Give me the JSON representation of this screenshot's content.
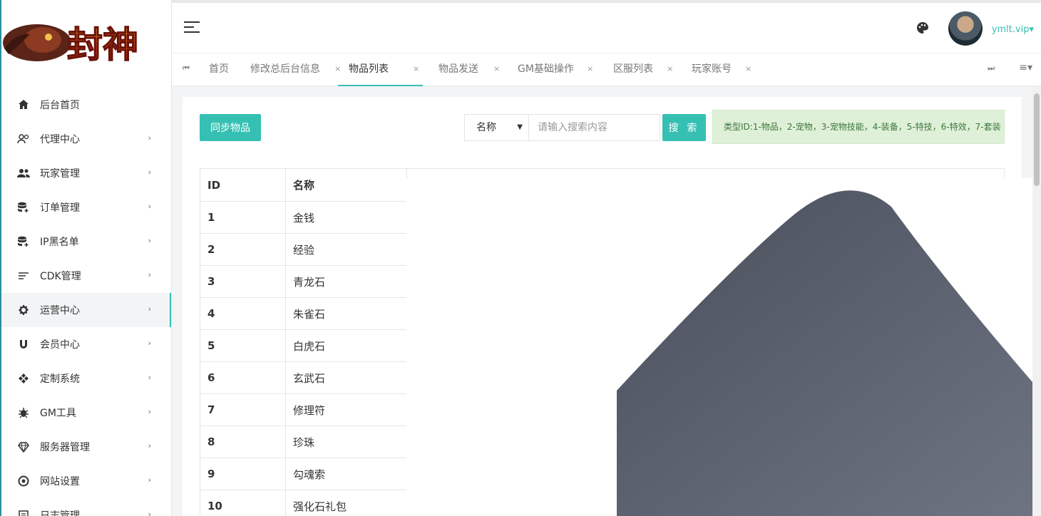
{
  "logo": {
    "text": "封神"
  },
  "sidebar": {
    "items": [
      {
        "label": "后台首页",
        "icon": "home-icon"
      },
      {
        "label": "代理中心",
        "icon": "users-outline-icon"
      },
      {
        "label": "玩家管理",
        "icon": "users-icon"
      },
      {
        "label": "订单管理",
        "icon": "database-add-icon"
      },
      {
        "label": "IP黑名单",
        "icon": "database-add-icon"
      },
      {
        "label": "CDK管理",
        "icon": "list-icon"
      },
      {
        "label": "运营中心",
        "icon": "gear-icon"
      },
      {
        "label": "会员中心",
        "icon": "magnet-icon"
      },
      {
        "label": "定制系统",
        "icon": "puzzle-icon"
      },
      {
        "label": "GM工具",
        "icon": "bug-icon"
      },
      {
        "label": "服务器管理",
        "icon": "diamond-icon"
      },
      {
        "label": "网站设置",
        "icon": "settings-circle-icon"
      },
      {
        "label": "日志管理",
        "icon": "log-icon"
      }
    ],
    "active_index": 6
  },
  "header": {
    "username": "ymlt.vip"
  },
  "tabs": [
    {
      "label": "首页"
    },
    {
      "label": "修改总后台信息"
    },
    {
      "label": "物品列表"
    },
    {
      "label": "物品发送"
    },
    {
      "label": "GM基础操作"
    },
    {
      "label": "区服列表"
    },
    {
      "label": "玩家账号"
    }
  ],
  "toolbar": {
    "sync_label": "同步物品",
    "select_value": "名称",
    "search_placeholder": "请输入搜索内容",
    "search_label": "搜 索",
    "alert_text": "类型ID:1-物品，2-宠物，3-宠物技能，4-装备，5-特技，6-特效，7-套装"
  },
  "table": {
    "headers": [
      "ID",
      "名称"
    ],
    "rows": [
      [
        "1",
        "金钱"
      ],
      [
        "2",
        "经验"
      ],
      [
        "3",
        "青龙石"
      ],
      [
        "4",
        "朱雀石"
      ],
      [
        "5",
        "白虎石"
      ],
      [
        "6",
        "玄武石"
      ],
      [
        "7",
        "修理符"
      ],
      [
        "8",
        "珍珠"
      ],
      [
        "9",
        "勾魂索"
      ],
      [
        "10",
        "强化石礼包"
      ]
    ]
  },
  "colors": {
    "accent": "#36c0b3",
    "alert_bg": "#dff0d8",
    "alert_text": "#3c763d",
    "overlay_dark": "#5a6170"
  }
}
